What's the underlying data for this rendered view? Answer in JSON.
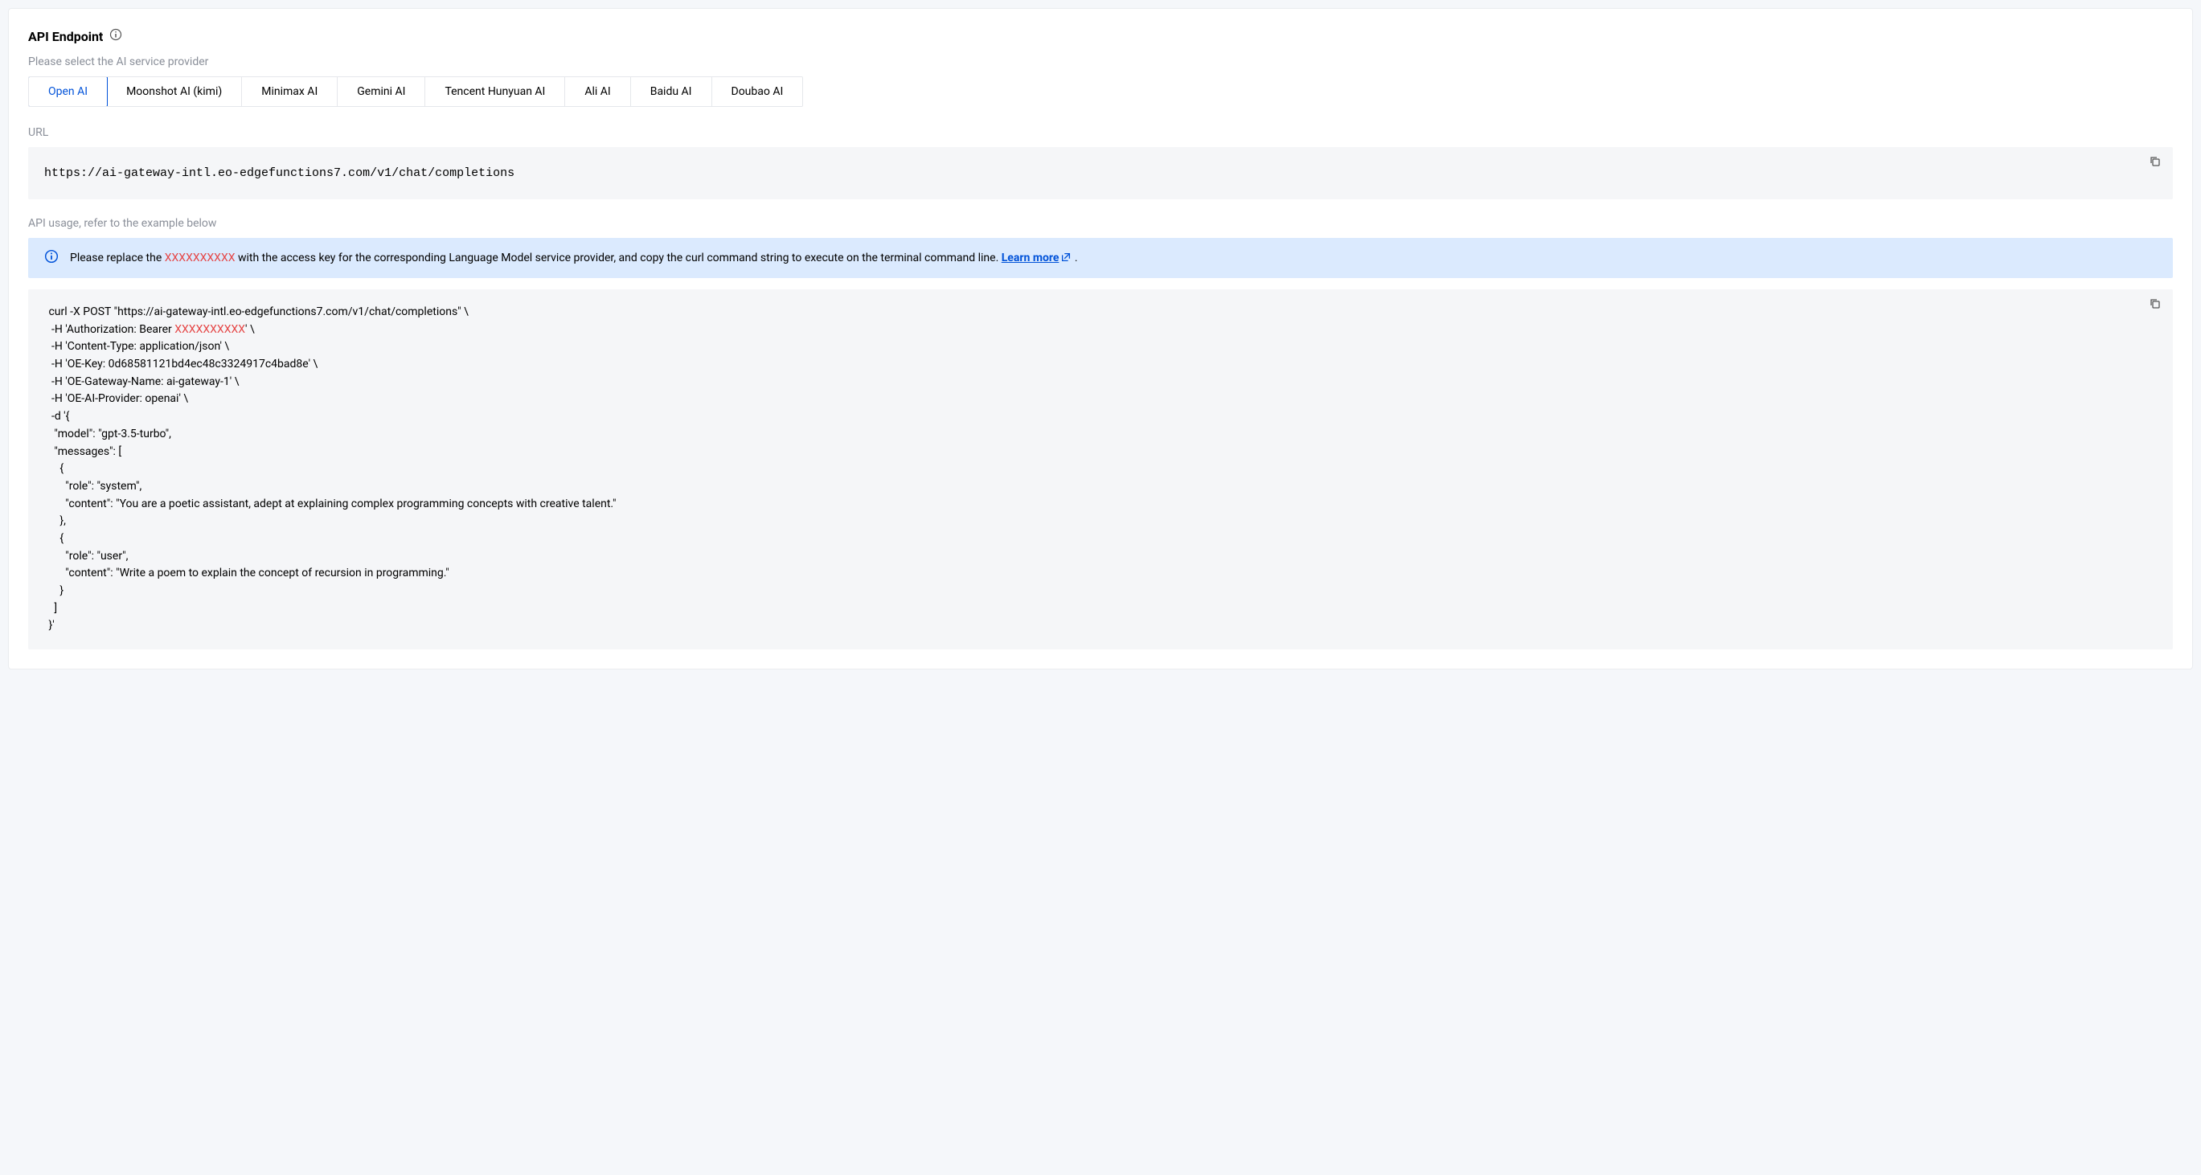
{
  "title": "API Endpoint",
  "select_provider_label": "Please select the AI service provider",
  "providers": [
    {
      "label": "Open AI",
      "active": true
    },
    {
      "label": "Moonshot AI (kimi)",
      "active": false
    },
    {
      "label": "Minimax AI",
      "active": false
    },
    {
      "label": "Gemini AI",
      "active": false
    },
    {
      "label": "Tencent Hunyuan AI",
      "active": false
    },
    {
      "label": "Ali AI",
      "active": false
    },
    {
      "label": "Baidu AI",
      "active": false
    },
    {
      "label": "Doubao AI",
      "active": false
    }
  ],
  "url_label": "URL",
  "url_value": "https://ai-gateway-intl.eo-edgefunctions7.com/v1/chat/completions",
  "usage_label": "API usage, refer to the example below",
  "alert": {
    "prefix": "Please replace the ",
    "placeholder": "XXXXXXXXXX",
    "suffix": " with the access key for the corresponding Language Model service provider, and copy the curl command string to execute on the terminal command line. ",
    "learn_more": "Learn more",
    "trailing": " ."
  },
  "curl": {
    "line1": " curl -X POST \"https://ai-gateway-intl.eo-edgefunctions7.com/v1/chat/completions\" \\",
    "line2_pre": "  -H 'Authorization: Bearer ",
    "line2_ph": "XXXXXXXXXX",
    "line2_post": "' \\",
    "line3": "  -H 'Content-Type: application/json' \\",
    "line4": "  -H 'OE-Key: 0d68581121bd4ec48c3324917c4bad8e' \\",
    "line5": "  -H 'OE-Gateway-Name: ai-gateway-1' \\",
    "line6": "  -H 'OE-AI-Provider: openai' \\",
    "line7": "  -d '{",
    "line8": "   \"model\": \"gpt-3.5-turbo\",",
    "line9": "   \"messages\": [",
    "line10": "     {",
    "line11": "       \"role\": \"system\",",
    "line12": "       \"content\": \"You are a poetic assistant, adept at explaining complex programming concepts with creative talent.\"",
    "line13": "     },",
    "line14": "     {",
    "line15": "       \"role\": \"user\",",
    "line16": "       \"content\": \"Write a poem to explain the concept of recursion in programming.\"",
    "line17": "     }",
    "line18": "   ]",
    "line19": " }'"
  }
}
